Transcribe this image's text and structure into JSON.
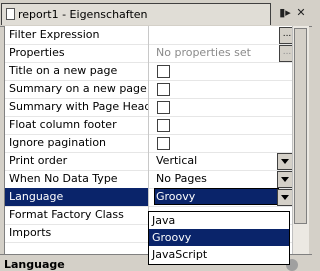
{
  "window": {
    "title": "report1 - Eigenschaften"
  },
  "properties": [
    {
      "name": "Filter Expression",
      "value": "",
      "kind": "button"
    },
    {
      "name": "Properties",
      "value": "No properties set",
      "kind": "button_placeholder"
    },
    {
      "name": "Title on a new page",
      "value": "",
      "kind": "checkbox"
    },
    {
      "name": "Summary on a new page",
      "value": "",
      "kind": "checkbox"
    },
    {
      "name": "Summary with Page Header a",
      "value": "",
      "kind": "checkbox"
    },
    {
      "name": "Float column footer",
      "value": "",
      "kind": "checkbox"
    },
    {
      "name": "Ignore pagination",
      "value": "",
      "kind": "checkbox"
    },
    {
      "name": "Print order",
      "value": "Vertical",
      "kind": "combo"
    },
    {
      "name": "When No Data Type",
      "value": "No Pages",
      "kind": "combo"
    },
    {
      "name": "Language",
      "value": "Groovy",
      "kind": "combo_selected"
    },
    {
      "name": "Format Factory Class",
      "value": "",
      "kind": "text"
    },
    {
      "name": "Imports",
      "value": "",
      "kind": "text"
    }
  ],
  "dropdown": {
    "options": [
      "Java",
      "Groovy",
      "JavaScript"
    ],
    "selected": "Groovy"
  },
  "bottom": {
    "label": "Language"
  },
  "colors": {
    "selection": "#0a246a",
    "panel": "#d4d0c8"
  }
}
